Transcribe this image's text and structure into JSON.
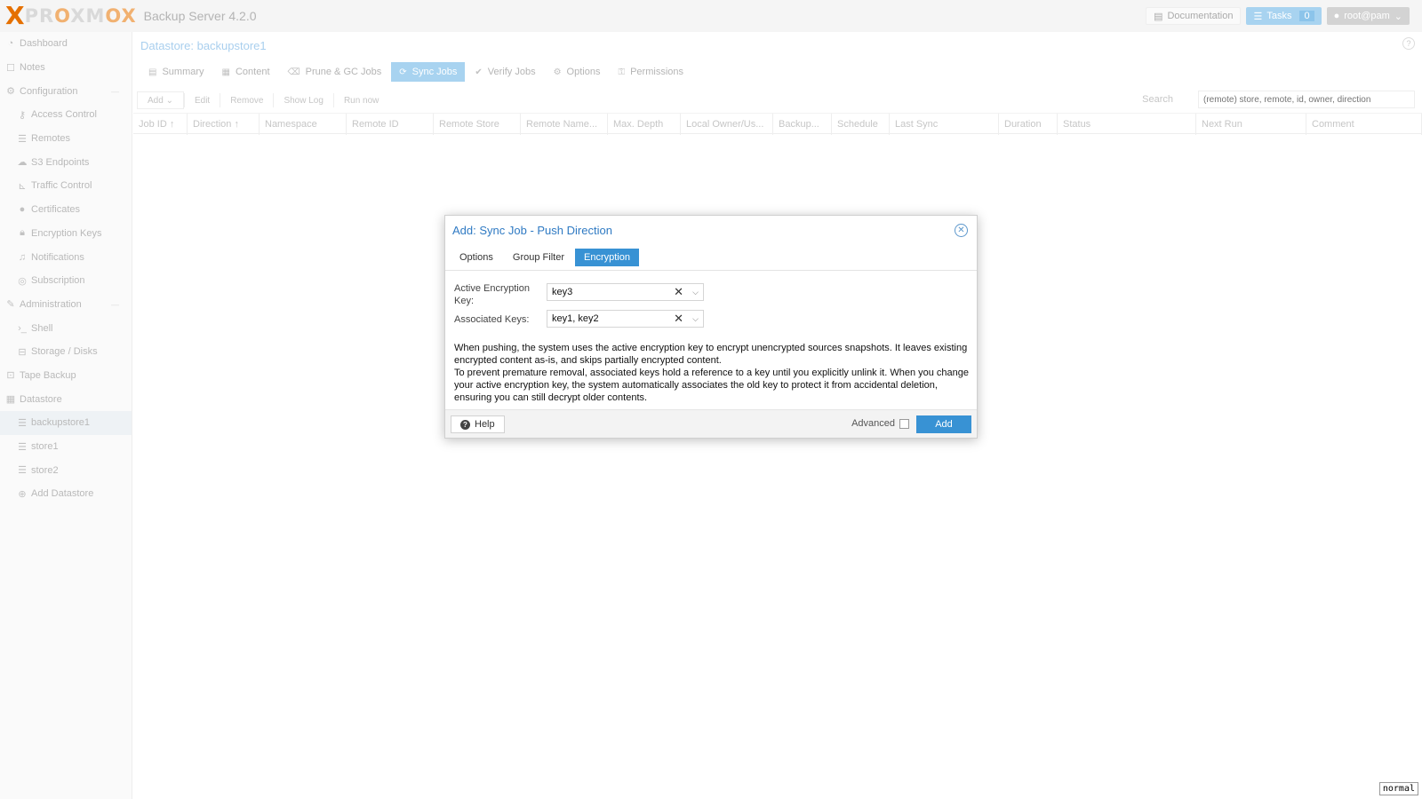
{
  "header": {
    "logo_x": "X",
    "logo_pro": "PR",
    "logo_o1": "O",
    "logo_xm": "XM",
    "logo_o2": "O",
    "logo_x2": "X",
    "product": "Backup Server 4.2.0",
    "documentation": "Documentation",
    "tasks_label": "Tasks",
    "tasks_count": "0",
    "user": "root@pam"
  },
  "sidebar": {
    "items": [
      {
        "label": "Dashboard",
        "icon": "dashboard-icon"
      },
      {
        "label": "Notes",
        "icon": "notes-icon"
      },
      {
        "label": "Configuration",
        "icon": "gears-icon"
      },
      {
        "label": "Access Control",
        "icon": "key-icon"
      },
      {
        "label": "Remotes",
        "icon": "server-icon"
      },
      {
        "label": "S3 Endpoints",
        "icon": "cloud-icon"
      },
      {
        "label": "Traffic Control",
        "icon": "chart-icon"
      },
      {
        "label": "Certificates",
        "icon": "certificate-icon"
      },
      {
        "label": "Encryption Keys",
        "icon": "lock-icon"
      },
      {
        "label": "Notifications",
        "icon": "bell-icon"
      },
      {
        "label": "Subscription",
        "icon": "support-icon"
      },
      {
        "label": "Administration",
        "icon": "wrench-icon"
      },
      {
        "label": "Shell",
        "icon": "terminal-icon"
      },
      {
        "label": "Storage / Disks",
        "icon": "disk-icon"
      },
      {
        "label": "Tape Backup",
        "icon": "tape-icon"
      },
      {
        "label": "Datastore",
        "icon": "archive-icon"
      },
      {
        "label": "backupstore1",
        "icon": "database-icon"
      },
      {
        "label": "store1",
        "icon": "database-icon"
      },
      {
        "label": "store2",
        "icon": "database-icon"
      },
      {
        "label": "Add Datastore",
        "icon": "plus-circle-icon"
      }
    ]
  },
  "main": {
    "title": "Datastore: backupstore1",
    "help_glyph": "?",
    "tabs": [
      {
        "label": "Summary"
      },
      {
        "label": "Content"
      },
      {
        "label": "Prune & GC Jobs"
      },
      {
        "label": "Sync Jobs"
      },
      {
        "label": "Verify Jobs"
      },
      {
        "label": "Options"
      },
      {
        "label": "Permissions"
      }
    ],
    "toolbar": {
      "add": "Add",
      "edit": "Edit",
      "remove": "Remove",
      "show_log": "Show Log",
      "run_now": "Run now",
      "search_label": "Search",
      "search_placeholder": "(remote) store, remote, id, owner, direction"
    },
    "columns": [
      "Job ID",
      "Direction",
      "Namespace",
      "Remote ID",
      "Remote Store",
      "Remote Name...",
      "Max. Depth",
      "Local Owner/Us...",
      "Backup...",
      "Schedule",
      "Last Sync",
      "Duration",
      "Status",
      "Next Run",
      "Comment"
    ]
  },
  "dialog": {
    "title": "Add: Sync Job - Push Direction",
    "tabs": [
      {
        "label": "Options"
      },
      {
        "label": "Group Filter"
      },
      {
        "label": "Encryption"
      }
    ],
    "active_key_label_1": "Active Encryption",
    "active_key_label_2": "Key:",
    "active_key_value": "key3",
    "associated_label": "Associated Keys:",
    "associated_value": "key1, key2",
    "desc_1": "When pushing, the system uses the active encryption key to encrypt unencrypted sources snapshots. It leaves existing encrypted content as-is, and skips partially encrypted content.",
    "desc_2": "To prevent premature removal, associated keys hold a reference to a key until you explicitly unlink it. When you change your active encryption key, the system automatically associates the old key to protect it from accidental deletion, ensuring you can still decrypt older contents.",
    "help": "Help",
    "advanced": "Advanced",
    "add": "Add"
  },
  "mode_badge": "normal",
  "colors": {
    "accent": "#3892d4",
    "logo_orange": "#e57000",
    "title_blue": "#2f7ac3"
  }
}
